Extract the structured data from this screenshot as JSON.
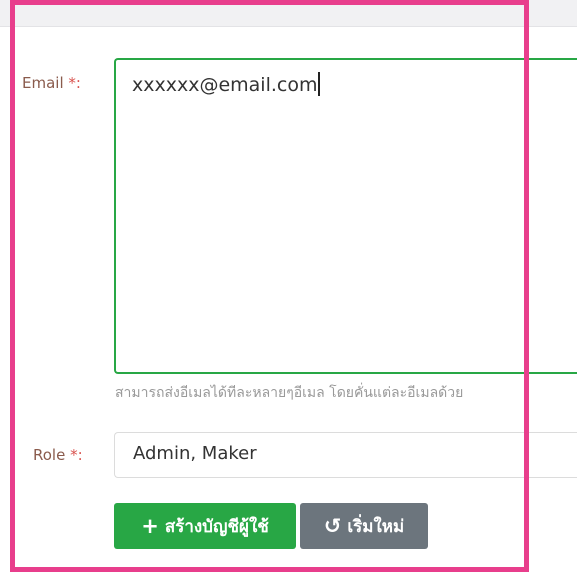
{
  "form": {
    "email_label": "Email",
    "email_required": "*:",
    "email_value": "xxxxxx@email.com",
    "email_help": "สามารถส่งอีเมลได้ทีละหลายๆอีเมล โดยคั่นแต่ละอีเมลด้วย",
    "role_label": "Role",
    "role_required": "*:",
    "role_value": "Admin, Maker"
  },
  "buttons": {
    "create_icon": "+",
    "create_label": "สร้างบัญชีผู้ใช้",
    "reset_icon": "↺",
    "reset_label": "เริ่มใหม่"
  },
  "colors": {
    "highlight": "#e83e8c",
    "primary": "#28a745",
    "secondary": "#6c757d",
    "required": "#d9534f"
  },
  "icons": {
    "create": "plus-icon",
    "reset": "undo-icon"
  }
}
